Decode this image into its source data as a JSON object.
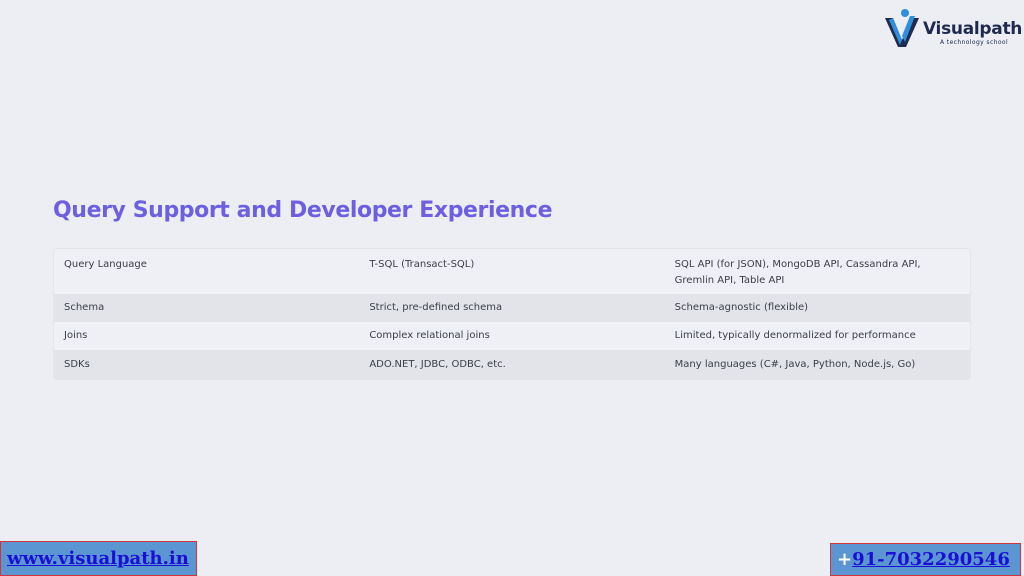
{
  "brand": {
    "name": "Visualpath",
    "tagline": "A technology school",
    "colors": {
      "primary": "#1f2a4f",
      "accent": "#2f8fdc",
      "title": "#6d5fe0"
    }
  },
  "title": "Query Support and Developer Experience",
  "table": {
    "rows": [
      [
        "Query Language",
        "T-SQL (Transact-SQL)",
        "SQL API (for JSON), MongoDB API, Cassandra API, Gremlin API, Table API"
      ],
      [
        "Schema",
        "Strict, pre-defined schema",
        "Schema-agnostic (flexible)"
      ],
      [
        "Joins",
        "Complex relational joins",
        "Limited, typically denormalized for performance"
      ],
      [
        "SDKs",
        "ADO.NET, JDBC, ODBC, etc.",
        "Many languages (C#, Java, Python, Node.js, Go)"
      ]
    ]
  },
  "footer": {
    "website": "www.visualpath.in",
    "phone_prefix": "+",
    "phone": "91-7032290546"
  }
}
